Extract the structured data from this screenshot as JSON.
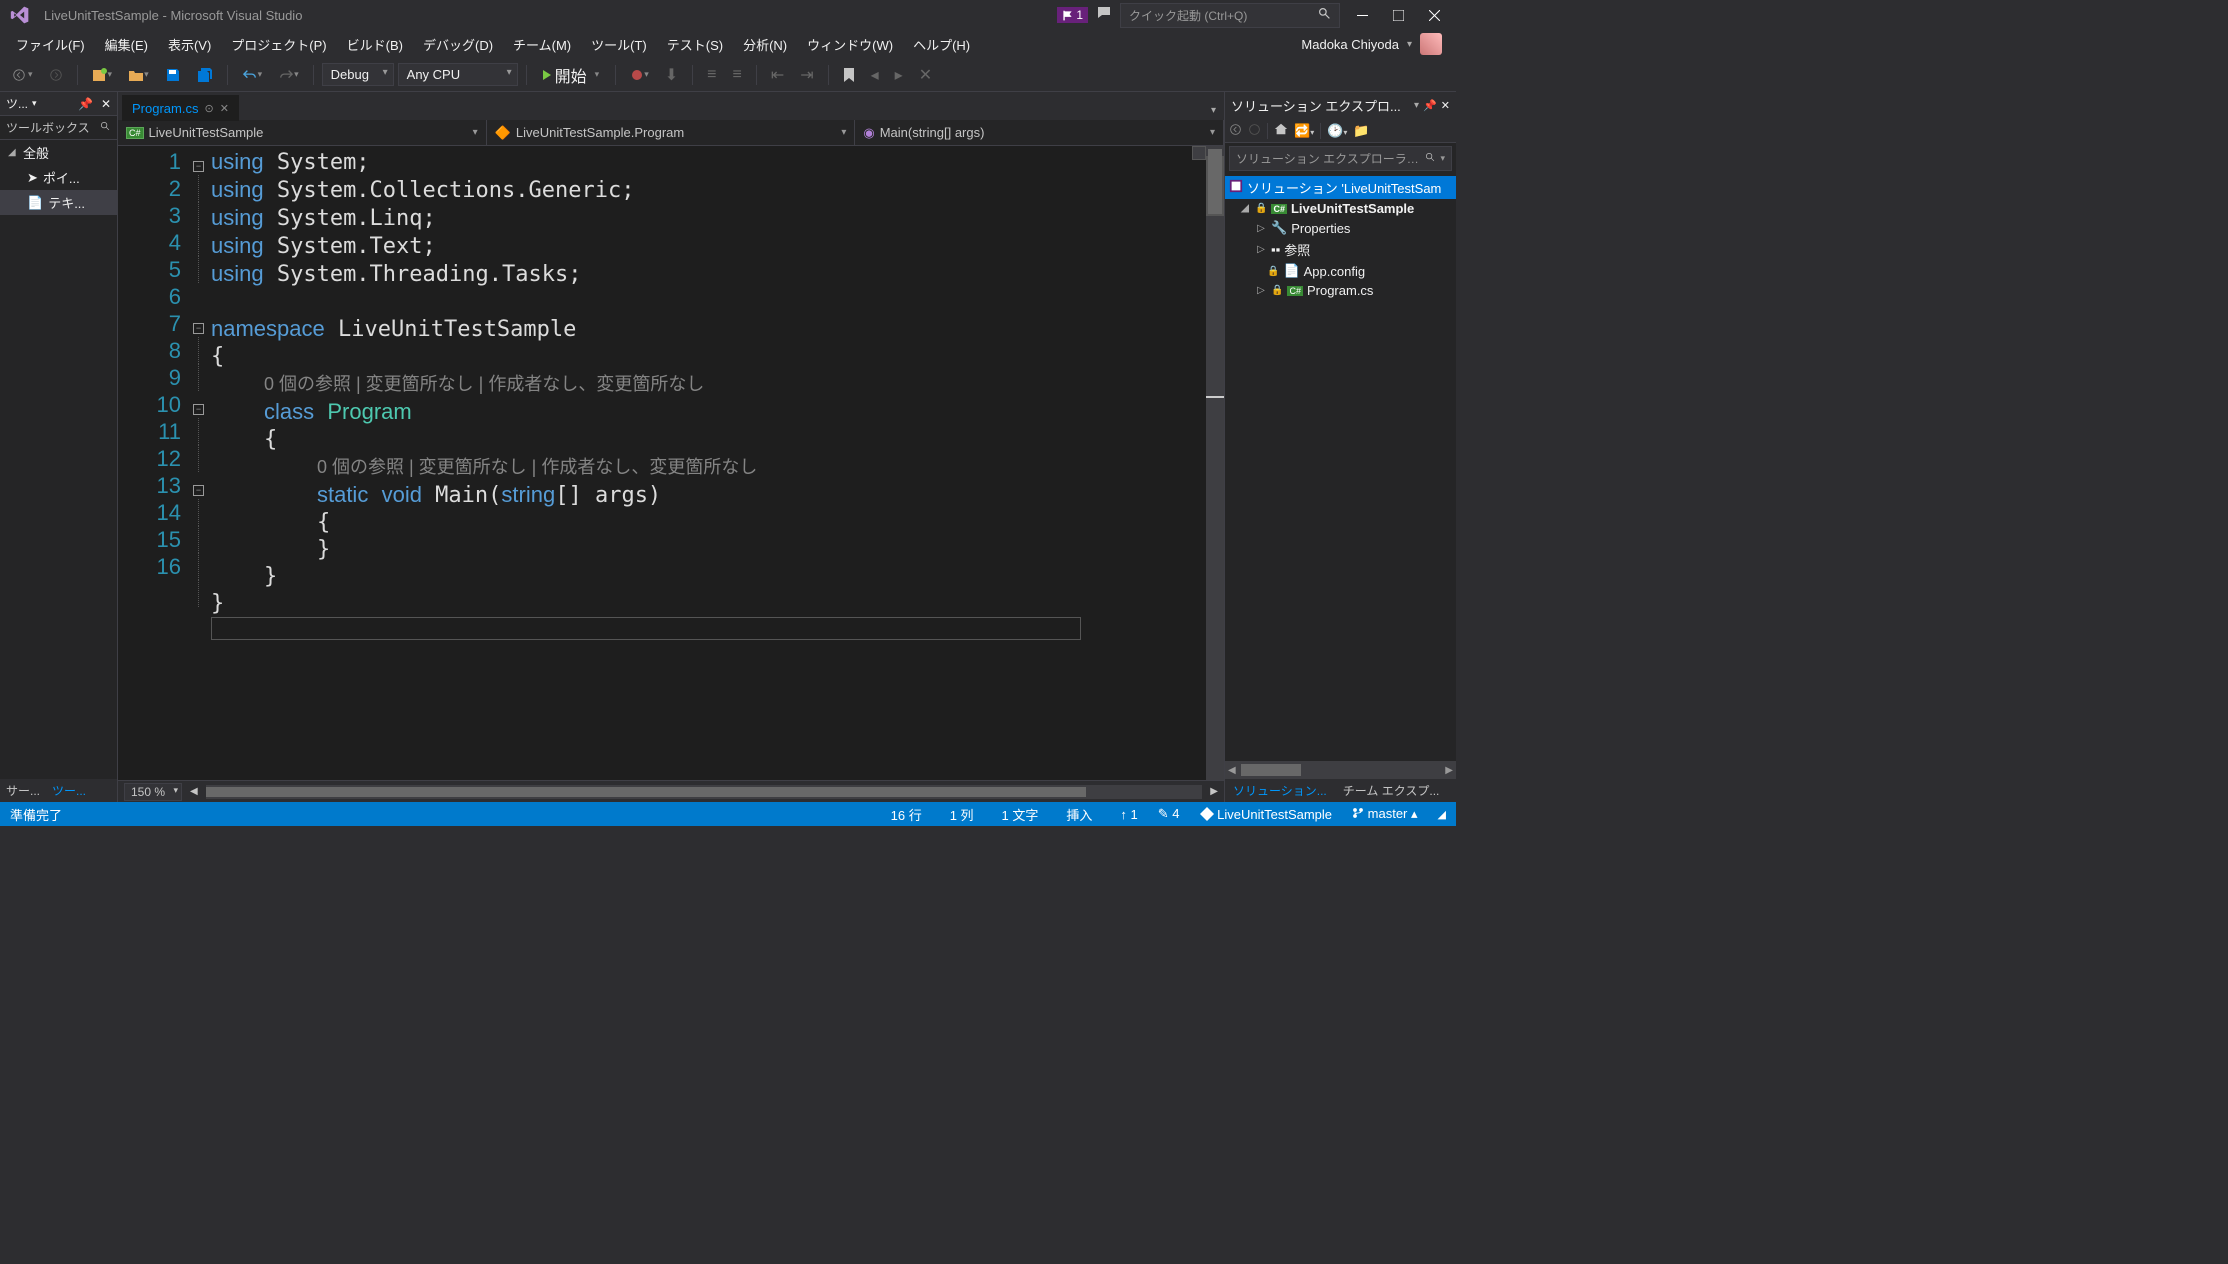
{
  "title": "LiveUnitTestSample - Microsoft Visual Studio",
  "notification_count": "1",
  "quick_launch_placeholder": "クイック起動 (Ctrl+Q)",
  "user_name": "Madoka Chiyoda",
  "menus": [
    "ファイル(F)",
    "編集(E)",
    "表示(V)",
    "プロジェクト(P)",
    "ビルド(B)",
    "デバッグ(D)",
    "チーム(M)",
    "ツール(T)",
    "テスト(S)",
    "分析(N)",
    "ウィンドウ(W)",
    "ヘルプ(H)"
  ],
  "toolbar": {
    "config": "Debug",
    "platform": "Any CPU",
    "start_label": "開始"
  },
  "toolbox": {
    "title": "ツ...",
    "search_label": "ツールボックス",
    "category": "全般",
    "items": [
      "ポイ...",
      "テキ..."
    ]
  },
  "left_tabs": [
    "サー...",
    "ツー..."
  ],
  "document": {
    "tab": "Program.cs",
    "nav_project": "LiveUnitTestSample",
    "nav_class": "LiveUnitTestSample.Program",
    "nav_member": "Main(string[] args)",
    "zoom": "150 %",
    "line_numbers": [
      "1",
      "2",
      "3",
      "4",
      "5",
      "6",
      "7",
      "8",
      "",
      "9",
      "10",
      "",
      "11",
      "12",
      "13",
      "14",
      "15",
      "16"
    ],
    "codelens1": "0 個の参照 | 変更箇所なし | 作成者なし、変更箇所なし",
    "codelens2": "0 個の参照 | 変更箇所なし | 作成者なし、変更箇所なし"
  },
  "solution_explorer": {
    "title": "ソリューション エクスプロ...",
    "search_placeholder": "ソリューション エクスプローラー の",
    "solution": "ソリューション 'LiveUnitTestSam",
    "project": "LiveUnitTestSample",
    "nodes": [
      "Properties",
      "参照",
      "App.config",
      "Program.cs"
    ]
  },
  "right_tabs": [
    "ソリューション...",
    "チーム エクスプ..."
  ],
  "statusbar": {
    "ready": "準備完了",
    "line": "16 行",
    "col": "1 列",
    "char": "1 文字",
    "ins": "挿入",
    "up": "1",
    "pending": "4",
    "repo": "LiveUnitTestSample",
    "branch": "master"
  }
}
